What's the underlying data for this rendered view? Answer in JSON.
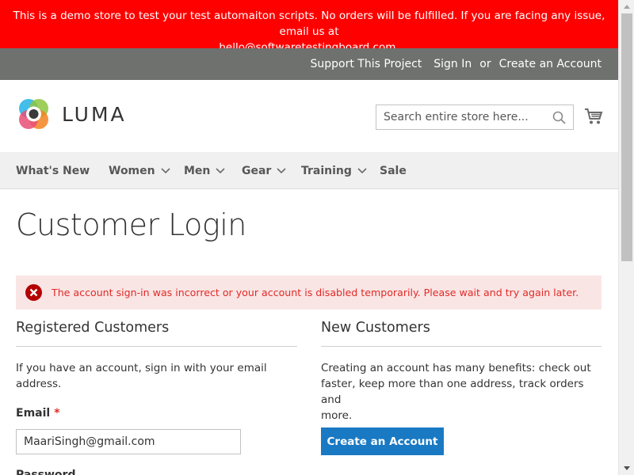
{
  "demo_banner": {
    "line1": "This is a demo store to test your test automaiton scripts. No orders will be fulfilled. If you are facing any issue, email us at",
    "line2": "hello@softwaretestingboard.com."
  },
  "header_links": {
    "support": "Support This Project",
    "sign_in": "Sign In",
    "or": "or",
    "create_account": "Create an Account"
  },
  "logo": {
    "text": "LUMA"
  },
  "search": {
    "placeholder": "Search entire store here..."
  },
  "nav": {
    "items": [
      {
        "label": "What's New",
        "has_submenu": false
      },
      {
        "label": "Women",
        "has_submenu": true
      },
      {
        "label": "Men",
        "has_submenu": true
      },
      {
        "label": "Gear",
        "has_submenu": true
      },
      {
        "label": "Training",
        "has_submenu": true
      },
      {
        "label": "Sale",
        "has_submenu": false
      }
    ]
  },
  "page": {
    "title": "Customer Login"
  },
  "error": {
    "text": "The account sign-in was incorrect or your account is disabled temporarily. Please wait and try again later."
  },
  "registered": {
    "title": "Registered Customers",
    "intro_line1": "If you have an account, sign in with your email",
    "intro_line2": "address.",
    "email_label": "Email",
    "required_mark": "*",
    "email_value": "MaariSingh@gmail.com",
    "password_label": "Password"
  },
  "new_customers": {
    "title": "New Customers",
    "text_line1": "Creating an account has many benefits: check out",
    "text_line2": "faster, keep more than one address, track orders and",
    "text_line3": "more.",
    "button": "Create an Account"
  },
  "colors": {
    "banner": "#ff0000",
    "panel": "#6e716e",
    "nav_bg": "#f0f0f0",
    "error_bg": "#fae5e5",
    "error_text": "#e02b27",
    "primary_button": "#1979c3"
  },
  "icons": [
    "luma-logo-icon",
    "search-icon",
    "cart-icon",
    "chevron-down-icon",
    "error-icon"
  ]
}
